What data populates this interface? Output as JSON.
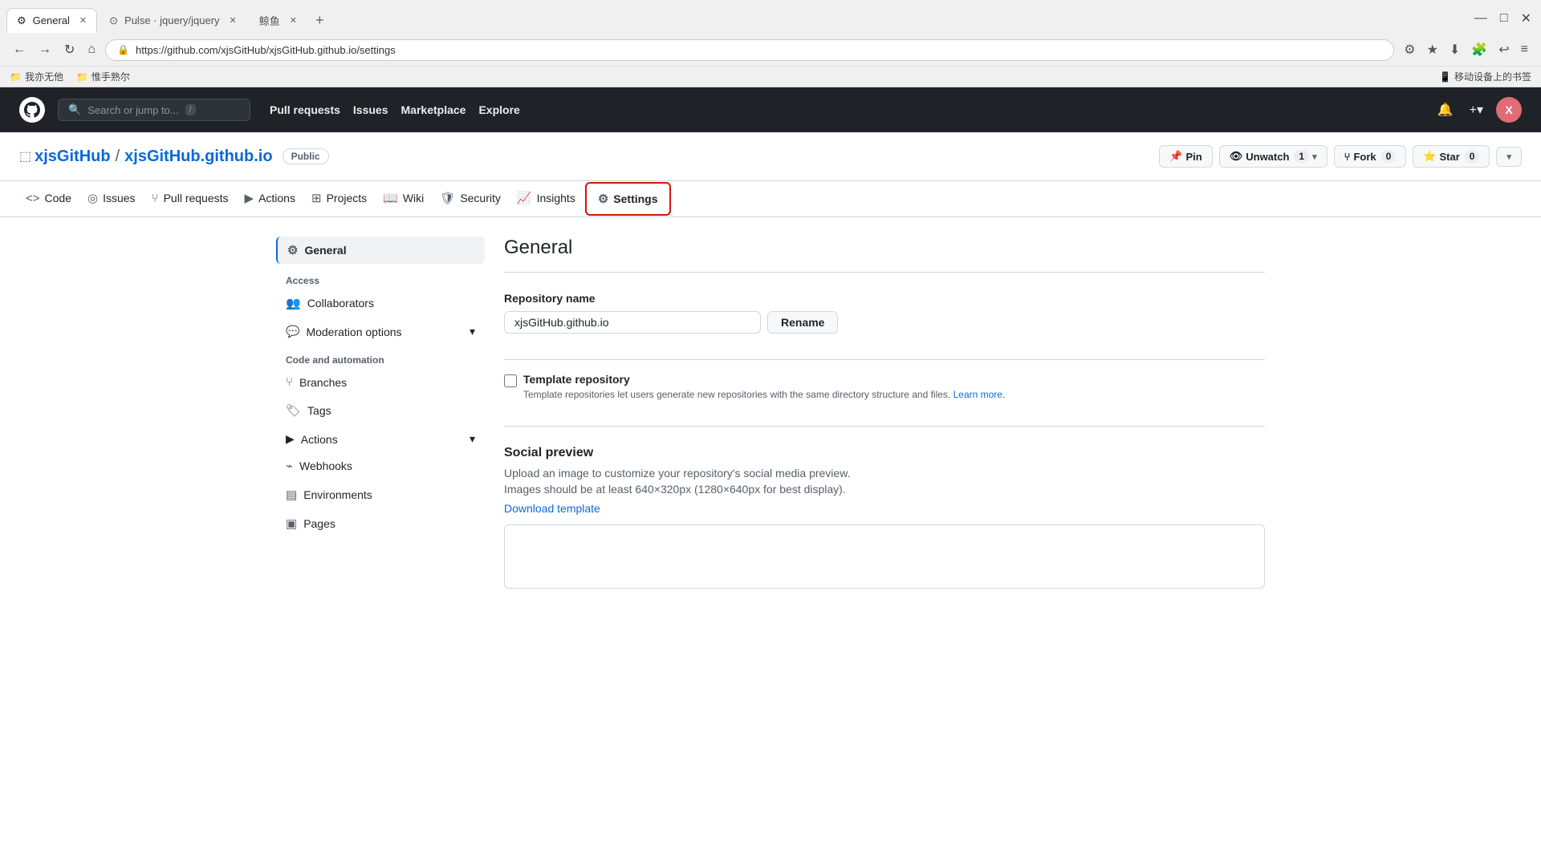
{
  "browser": {
    "tabs": [
      {
        "id": "general",
        "title": "General",
        "favicon": "⚙",
        "active": true
      },
      {
        "id": "pulse",
        "title": "Pulse · jquery/jquery",
        "favicon": "⊙",
        "active": false
      },
      {
        "id": "fish",
        "title": "鲸鱼",
        "favicon": "",
        "active": false
      }
    ],
    "url": "https://github.com/xjsGitHub/xjsGitHub.github.io/settings",
    "bookmarks": [
      {
        "label": "我亦无他",
        "icon": "📁"
      },
      {
        "label": "惟手熟尔",
        "icon": "📁"
      }
    ],
    "right_bookmark": "移动设备上的书签"
  },
  "github": {
    "search_placeholder": "Search or jump to...",
    "search_kbd": "/",
    "nav": [
      {
        "label": "Pull requests"
      },
      {
        "label": "Issues"
      },
      {
        "label": "Marketplace"
      },
      {
        "label": "Explore"
      }
    ],
    "logo_alt": "GitHub"
  },
  "repo": {
    "owner": "xjsGitHub",
    "owner_url": "#",
    "name": "xjsGitHub.github.io",
    "visibility": "Public",
    "actions": [
      {
        "icon": "📌",
        "label": "Pin"
      },
      {
        "icon": "👁",
        "label": "Unwatch",
        "count": "1"
      },
      {
        "icon": "⑂",
        "label": "Fork",
        "count": "0"
      },
      {
        "icon": "⭐",
        "label": "Star",
        "count": "0"
      }
    ]
  },
  "repo_nav": [
    {
      "id": "code",
      "icon": "<>",
      "label": "Code",
      "active": false
    },
    {
      "id": "issues",
      "icon": "◎",
      "label": "Issues",
      "active": false
    },
    {
      "id": "pull-requests",
      "icon": "⑂",
      "label": "Pull requests",
      "active": false
    },
    {
      "id": "actions",
      "icon": "▶",
      "label": "Actions",
      "active": false
    },
    {
      "id": "projects",
      "icon": "⊞",
      "label": "Projects",
      "active": false
    },
    {
      "id": "wiki",
      "icon": "📖",
      "label": "Wiki",
      "active": false
    },
    {
      "id": "security",
      "icon": "🛡",
      "label": "Security",
      "active": false
    },
    {
      "id": "insights",
      "icon": "📈",
      "label": "Insights",
      "active": false
    },
    {
      "id": "settings",
      "icon": "⚙",
      "label": "Settings",
      "active": true
    }
  ],
  "sidebar": {
    "general_label": "General",
    "access_section": "Access",
    "access_items": [
      {
        "id": "collaborators",
        "icon": "👥",
        "label": "Collaborators"
      }
    ],
    "moderation_label": "Moderation options",
    "code_automation_section": "Code and automation",
    "code_items": [
      {
        "id": "branches",
        "icon": "⑂",
        "label": "Branches"
      },
      {
        "id": "tags",
        "icon": "🏷",
        "label": "Tags"
      },
      {
        "id": "actions",
        "icon": "▶",
        "label": "Actions"
      },
      {
        "id": "webhooks",
        "icon": "⌁",
        "label": "Webhooks"
      },
      {
        "id": "environments",
        "icon": "▤",
        "label": "Environments"
      },
      {
        "id": "pages",
        "icon": "▣",
        "label": "Pages"
      }
    ]
  },
  "settings_page": {
    "title": "General",
    "repo_name_label": "Repository name",
    "repo_name_value": "xjsGitHub.github.io",
    "rename_btn": "Rename",
    "template_repo_label": "Template repository",
    "template_repo_desc": "Template repositories let users generate new repositories with the same directory structure and files.",
    "learn_more": "Learn more.",
    "social_preview_title": "Social preview",
    "social_preview_desc": "Upload an image to customize your repository's social media preview.",
    "social_preview_note": "Images should be at least 640×320px (1280×640px for best display).",
    "download_template": "Download template"
  }
}
